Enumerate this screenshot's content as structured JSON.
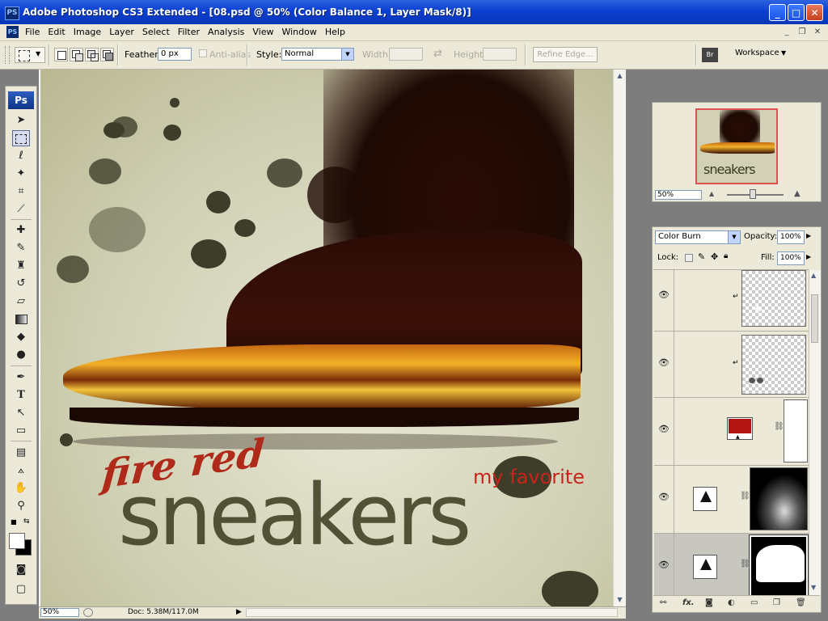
{
  "window": {
    "app_icon": "PS",
    "title": "Adobe Photoshop CS3 Extended - [08.psd @ 50% (Color Balance 1, Layer Mask/8)]",
    "controls": {
      "minimize": "_",
      "maximize": "□",
      "close": "✕"
    }
  },
  "menu": {
    "icon": "PS",
    "items": [
      "File",
      "Edit",
      "Image",
      "Layer",
      "Select",
      "Filter",
      "Analysis",
      "View",
      "Window",
      "Help"
    ],
    "mdi": {
      "minimize": "_",
      "restore": "❐",
      "close": "✕"
    }
  },
  "options": {
    "feather_label": "Feather:",
    "feather_value": "0 px",
    "antialias_label": "Anti-alias",
    "style_label": "Style:",
    "style_value": "Normal",
    "width_label": "Width:",
    "height_label": "Height:",
    "refine_edge": "Refine Edge...",
    "workspace": "Workspace"
  },
  "tools": {
    "logo": "Ps",
    "items": [
      "move",
      "marquee",
      "lasso",
      "magic-wand",
      "crop",
      "slice",
      "healing",
      "brush",
      "clone-stamp",
      "history-brush",
      "eraser",
      "gradient",
      "blur",
      "dodge",
      "pen",
      "type",
      "path-select",
      "shape",
      "notes",
      "eyedropper",
      "hand",
      "zoom"
    ]
  },
  "document": {
    "zoom": "50%",
    "doc_info": "Doc: 5.38M/117.0M",
    "art": {
      "title_red": "fire red",
      "title_main": "sneakers",
      "tagline": "my favorite"
    }
  },
  "navigator": {
    "zoom": "50%",
    "thumb_text": "sneakers"
  },
  "layers": {
    "blend_mode": "Color Burn",
    "opacity_label": "Opacity:",
    "opacity_value": "100%",
    "lock_label": "Lock:",
    "fill_label": "Fill:",
    "fill_value": "100%",
    "rows": [
      {
        "type": "clipped-transparent"
      },
      {
        "type": "clipped-transparent-spots"
      },
      {
        "type": "color-fill",
        "color": "#b31414"
      },
      {
        "type": "adjustment-mask-shoe"
      },
      {
        "type": "adjustment-mask-white",
        "selected": true
      }
    ],
    "footer_icons": [
      "link-icon",
      "fx-icon",
      "mask-icon",
      "adjustment-icon",
      "group-icon",
      "new-layer-icon",
      "trash-icon"
    ],
    "footer_fx": "fx."
  },
  "colors": {
    "titlebar": "#0b3fcf",
    "chrome": "#ece9d8",
    "accent_red": "#c8241b"
  }
}
